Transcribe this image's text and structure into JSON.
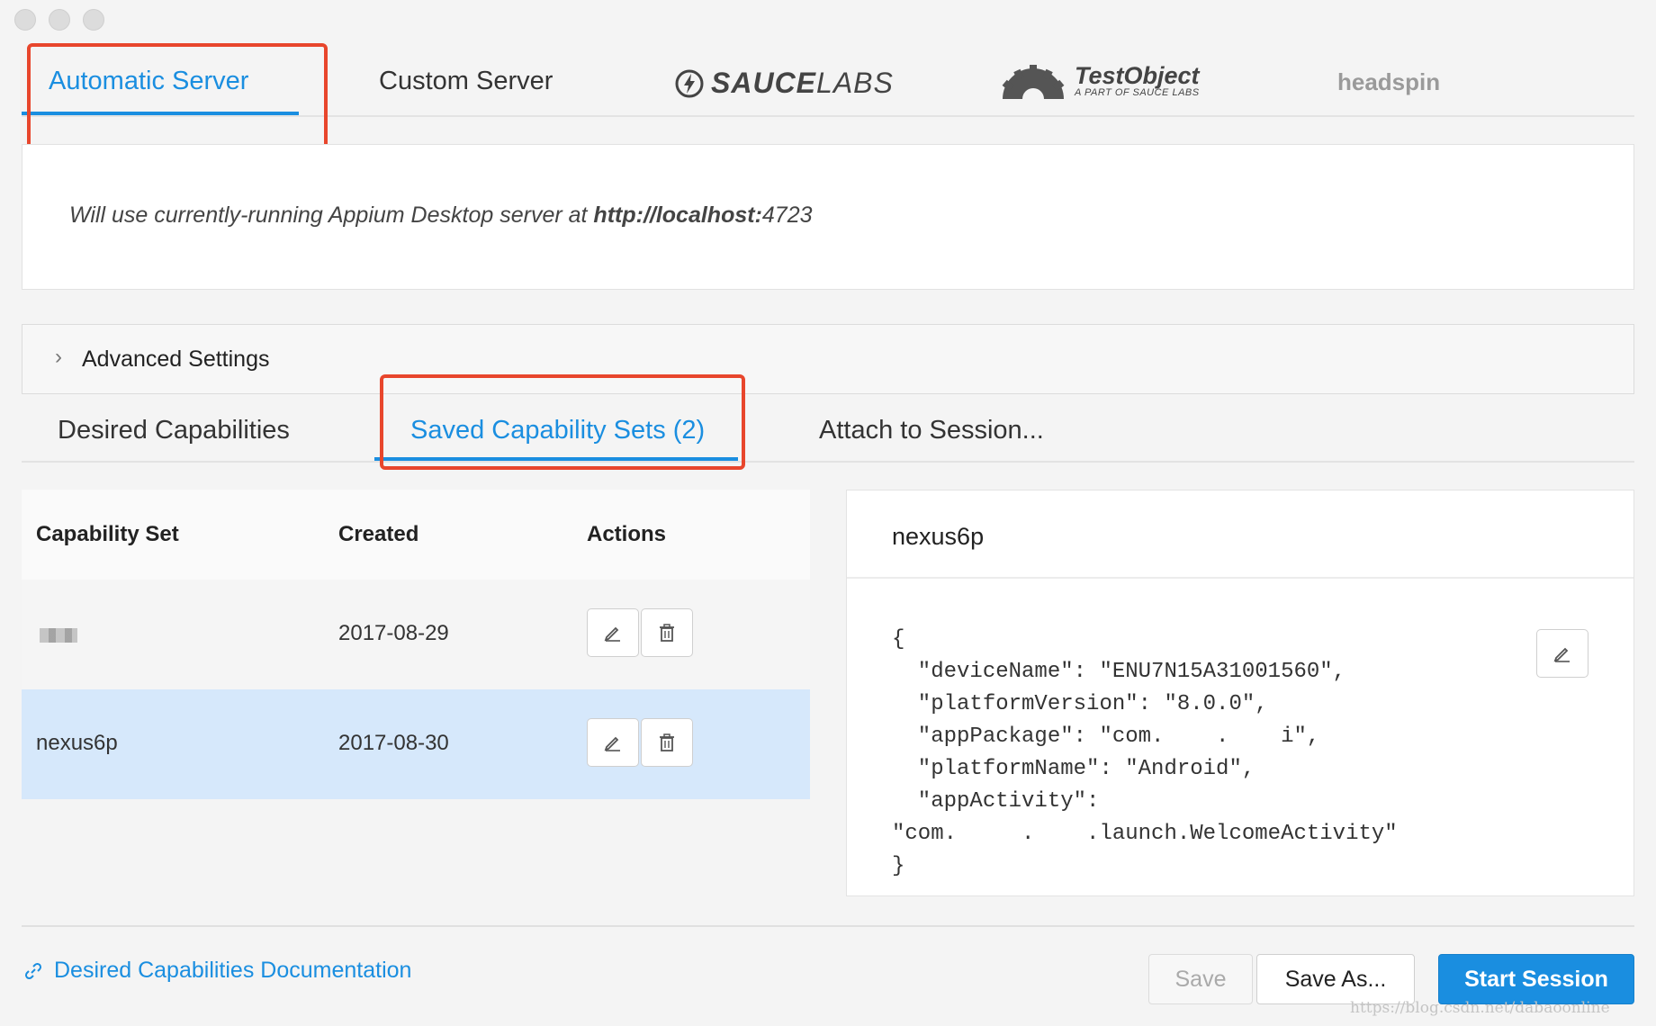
{
  "server_tabs": {
    "automatic": "Automatic Server",
    "custom": "Custom Server",
    "saucelabs_bold": "SAUCE",
    "saucelabs_light": "LABS",
    "testobject_title": "TestObject",
    "testobject_sub": "A PART OF SAUCE LABS",
    "headspin": "headspin"
  },
  "info": {
    "prefix": "Will use currently-running Appium Desktop server at ",
    "url_bold": "http://localhost:",
    "port": "4723"
  },
  "advanced": {
    "label": "Advanced Settings"
  },
  "cap_tabs": {
    "desired": "Desired Capabilities",
    "saved": "Saved Capability Sets (2)",
    "attach": "Attach to Session..."
  },
  "table": {
    "headers": {
      "set": "Capability Set",
      "created": "Created",
      "actions": "Actions"
    },
    "rows": [
      {
        "name": "",
        "created": "2017-08-29"
      },
      {
        "name": "nexus6p",
        "created": "2017-08-30"
      }
    ]
  },
  "detail": {
    "title": "nexus6p",
    "json": "{\n  \"deviceName\": \"ENU7N15A31001560\",\n  \"platformVersion\": \"8.0.0\",\n  \"appPackage\": \"com.    .    i\",\n  \"platformName\": \"Android\",\n  \"appActivity\":\n\"com.     .    .launch.WelcomeActivity\"\n}"
  },
  "footer": {
    "doc_link": "Desired Capabilities Documentation",
    "save": "Save",
    "save_as": "Save As...",
    "start": "Start Session"
  },
  "watermark": "https://blog.csdn.net/dabaoonline",
  "colors": {
    "accent": "#1a8ee0",
    "highlight": "#e8462c",
    "selected_row": "#d6e8fb"
  }
}
